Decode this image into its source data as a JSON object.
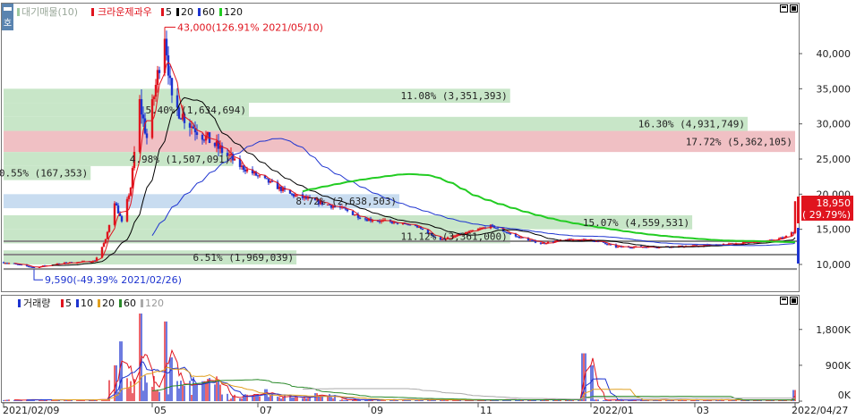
{
  "price_panel": {
    "legend": {
      "indicator_label": "대기매물(10)",
      "chart_label": "크라운제과우",
      "ma": [
        {
          "label": "5",
          "color": "#e0141e"
        },
        {
          "label": "20",
          "color": "#000000"
        },
        {
          "label": "60",
          "color": "#1e34d0"
        },
        {
          "label": "120",
          "color": "#22cc22"
        }
      ]
    },
    "side_button": "호",
    "high_annotation": "43,000(126.91% 2021/05/10)",
    "low_annotation": "9,590(-49.39% 2021/02/26)",
    "current_price": "18,950",
    "current_change": "( 29.79%)"
  },
  "volume_panel": {
    "legend": {
      "title": "거래량",
      "ma": [
        {
          "label": "5",
          "color": "#e0141e"
        },
        {
          "label": "10",
          "color": "#1e34d0"
        },
        {
          "label": "20",
          "color": "#e0a020"
        },
        {
          "label": "60",
          "color": "#2a8a2a"
        },
        {
          "label": "120",
          "color": "#aaaaaa"
        }
      ]
    }
  },
  "x_axis": {
    "ticks": [
      "2021/02/09",
      "05",
      "07",
      "09",
      "11",
      "2022/01",
      "03",
      "2022/04/27"
    ]
  },
  "colors": {
    "up": "#e0141e",
    "down": "#1e34d0",
    "ma5": "#e0141e",
    "ma20": "#000000",
    "ma60": "#1e34d0",
    "ma120": "#22cc22",
    "supply_band": "#c8e6c8",
    "supply_band_current": "#f0c0c4",
    "supply_band_support": "#c8dcf0"
  },
  "chart_data": [
    {
      "type": "candlestick",
      "ylim": [
        9000,
        43500
      ],
      "y_ticks": [
        10000,
        15000,
        20000,
        25000,
        30000,
        35000,
        40000
      ],
      "y_tick_labels": [
        "10,000",
        "15,000",
        "20,000",
        "25,000",
        "30,000",
        "35,000",
        "40,000"
      ],
      "x_start": "2021/02/09",
      "x_end": "2022/04/27",
      "price_path": [
        [
          "2021/02/09",
          10300
        ],
        [
          "2021/02/26",
          9590
        ],
        [
          "2021/03/15",
          10200
        ],
        [
          "2021/04/01",
          10500
        ],
        [
          "2021/04/07",
          13500
        ],
        [
          "2021/04/12",
          19000
        ],
        [
          "2021/04/16",
          16000
        ],
        [
          "2021/04/21",
          21000
        ],
        [
          "2021/04/26",
          33000
        ],
        [
          "2021/04/30",
          28000
        ],
        [
          "2021/05/10",
          43000
        ],
        [
          "2021/05/14",
          33000
        ],
        [
          "2021/05/24",
          30000
        ],
        [
          "2021/06/07",
          27000
        ],
        [
          "2021/06/21",
          24000
        ],
        [
          "2021/07/05",
          22000
        ],
        [
          "2021/07/19",
          20000
        ],
        [
          "2021/08/02",
          19000
        ],
        [
          "2021/08/16",
          18000
        ],
        [
          "2021/08/30",
          16500
        ],
        [
          "2021/09/13",
          16000
        ],
        [
          "2021/09/27",
          15500
        ],
        [
          "2021/10/11",
          13500
        ],
        [
          "2021/10/25",
          14500
        ],
        [
          "2021/11/08",
          15500
        ],
        [
          "2021/11/22",
          14000
        ],
        [
          "2021/12/06",
          13000
        ],
        [
          "2021/12/20",
          13500
        ],
        [
          "2022/01/03",
          13500
        ],
        [
          "2022/01/17",
          12500
        ],
        [
          "2022/02/07",
          12500
        ],
        [
          "2022/02/28",
          12600
        ],
        [
          "2022/03/21",
          12900
        ],
        [
          "2022/04/11",
          13300
        ],
        [
          "2022/04/20",
          13800
        ],
        [
          "2022/04/26",
          14600
        ],
        [
          "2022/04/27",
          18950
        ]
      ],
      "supply_bands": [
        {
          "label": "11.08% (3,351,393)",
          "low": 33000,
          "high": 35000,
          "fraction": 0.64
        },
        {
          "label": "5.40% (1,634,694)",
          "low": 31000,
          "high": 33000,
          "fraction": 0.31
        },
        {
          "label": "16.30% (4,931,749)",
          "low": 29000,
          "high": 31000,
          "fraction": 0.94
        },
        {
          "label": "17.72% (5,362,105)",
          "low": 26000,
          "high": 29000,
          "fraction": 1.0,
          "current": true
        },
        {
          "label": "4.98% (1,507,091)",
          "low": 24000,
          "high": 26000,
          "fraction": 0.29
        },
        {
          "label": "0.55% (167,353)",
          "low": 22000,
          "high": 24000,
          "fraction": 0.11
        },
        {
          "label": "8.72% (2,638,503)",
          "low": 18000,
          "high": 20000,
          "fraction": 0.5,
          "support": true
        },
        {
          "label": "15.07% (4,559,531)",
          "low": 15000,
          "high": 17000,
          "fraction": 0.87
        },
        {
          "label": "11.12% (3,361,000)",
          "low": 13000,
          "high": 15000,
          "fraction": 0.64
        },
        {
          "label": "6.51% (1,969,039)",
          "low": 10000,
          "high": 12000,
          "fraction": 0.37
        }
      ],
      "horizontal_lines": [
        9350,
        11400,
        13300
      ]
    },
    {
      "type": "bar",
      "ylim": [
        0,
        2400000
      ],
      "y_ticks": [
        0,
        900000,
        1800000
      ],
      "y_tick_labels": [
        "0K",
        "900K",
        "1,800K"
      ],
      "spikes": [
        [
          "2021/04/12",
          900000
        ],
        [
          "2021/04/16",
          1500000
        ],
        [
          "2021/04/26",
          2200000
        ],
        [
          "2021/05/10",
          2000000
        ],
        [
          "2021/05/14",
          1100000
        ],
        [
          "2021/06/01",
          500000
        ],
        [
          "2021/07/05",
          300000
        ],
        [
          "2021/08/02",
          200000
        ],
        [
          "2021/12/30",
          1200000
        ],
        [
          "2022/01/03",
          900000
        ],
        [
          "2022/04/27",
          280000
        ]
      ]
    }
  ]
}
